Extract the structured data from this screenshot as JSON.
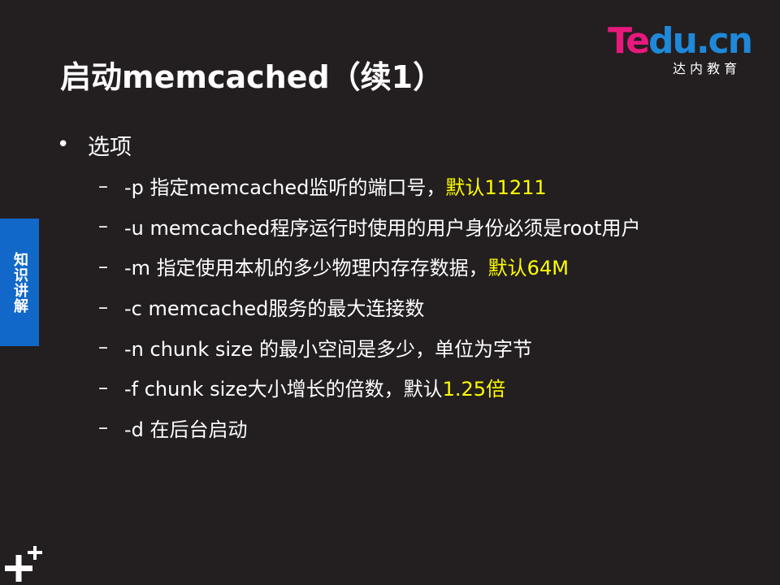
{
  "slide": {
    "title": "启动memcached（续1）",
    "logo": {
      "text_pink": "Te",
      "text_blue": "du.cn",
      "subtitle": "达内教育"
    },
    "side_tab": "知识讲解",
    "bullet": {
      "marker": "•",
      "text": "选项"
    },
    "items": [
      {
        "dash": "–",
        "text": "-p 指定memcached监听的端口号，",
        "highlight": "默认11211"
      },
      {
        "dash": "–",
        "text": "-u memcached程序运行时使用的用户身份必须是root用户",
        "highlight": ""
      },
      {
        "dash": "–",
        "text": "-m 指定使用本机的多少物理内存存数据，",
        "highlight": "默认64M"
      },
      {
        "dash": "–",
        "text": "-c memcached服务的最大连接数",
        "highlight": ""
      },
      {
        "dash": "–",
        "text": "-n chunk size 的最小空间是多少，单位为字节",
        "highlight": ""
      },
      {
        "dash": "–",
        "text": "-f chunk size大小增长的倍数，默认",
        "highlight": "1.25倍"
      },
      {
        "dash": "–",
        "text": "-d  在后台启动",
        "highlight": ""
      }
    ]
  },
  "colors": {
    "background": "#231f20",
    "highlight": "#ffff00",
    "side_tab": "#1168c9",
    "logo_pink": "#e8197d",
    "logo_blue": "#1f88d9"
  },
  "icons": {
    "corner": "plus-icon"
  }
}
